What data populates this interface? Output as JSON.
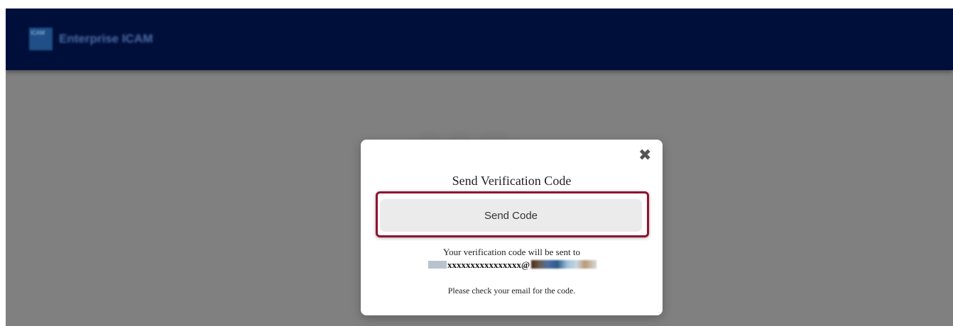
{
  "header": {
    "logo_text": "ICAM",
    "brand": "Enterprise ICAM"
  },
  "modal": {
    "close_glyph": "✖",
    "title": "Send Verification Code",
    "send_button_label": "Send Code",
    "info_text": "Your verification code will be sent to",
    "email_masked": "xxxxxxxxxxxxxxxx@",
    "check_text": "Please check your email for the code."
  },
  "icons": {
    "close": "close-icon"
  },
  "colors": {
    "header_bg": "#000e3a",
    "overlay_bg": "#808080",
    "highlight_border": "#8e1330",
    "button_bg": "#ebebeb"
  }
}
